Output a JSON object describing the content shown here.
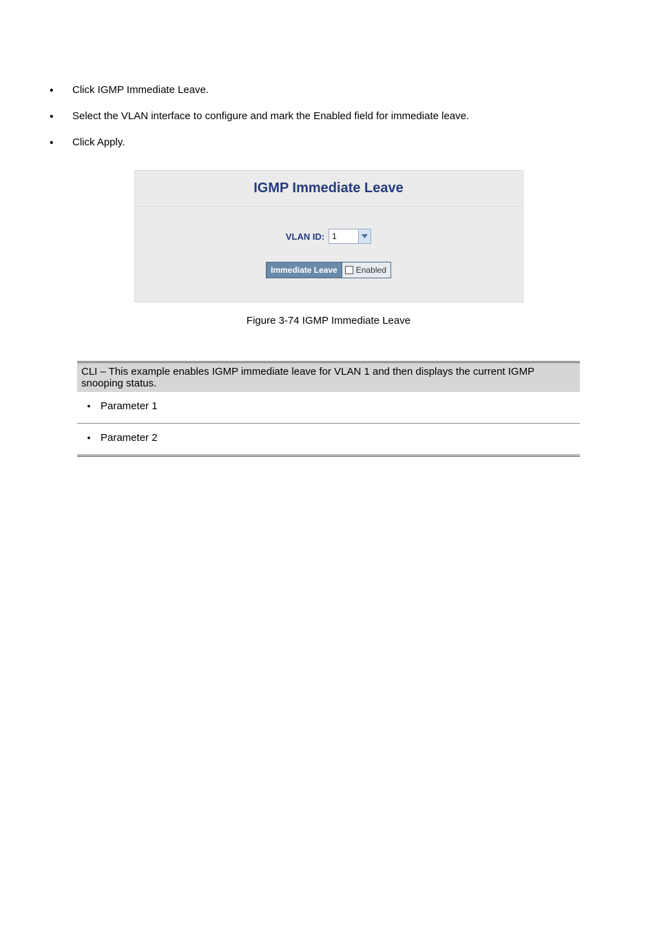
{
  "intro_items": [
    "Click IGMP Immediate Leave.",
    "Select the VLAN interface to configure and mark the Enabled field for immediate leave.",
    "Click Apply."
  ],
  "panel": {
    "title": "IGMP Immediate Leave",
    "vlan_label": "VLAN ID:",
    "vlan_value": "1",
    "immediate_leave_label": "Immediate Leave",
    "enabled_label": "Enabled"
  },
  "figure_caption": "Figure 3-74 IGMP Immediate Leave",
  "cli_text": {
    "heading": "CLI – This example enables IGMP immediate leave for VLAN 1 and then displays the current IGMP snooping status.",
    "param1": "Parameter 1",
    "param2": "Parameter 2"
  }
}
